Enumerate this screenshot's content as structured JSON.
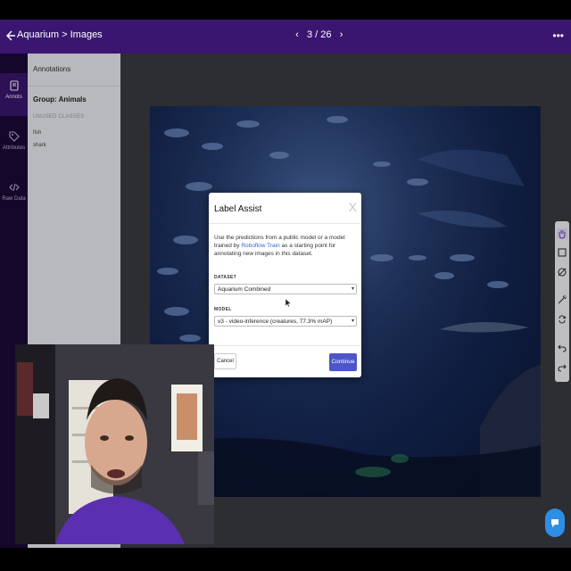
{
  "header": {
    "breadcrumb": "Aquarium > Images",
    "pager": "3 / 26",
    "prev_icon": "chevron-left-icon",
    "next_icon": "chevron-right-icon",
    "back_icon": "arrow-left-icon",
    "more_icon": "more-dots-icon"
  },
  "nav": {
    "items": [
      {
        "label": "Annots",
        "icon": "annotation-doc-icon",
        "active": true
      },
      {
        "label": "Attributes",
        "icon": "tag-icon",
        "active": false
      },
      {
        "label": "Raw Data",
        "icon": "code-icon",
        "active": false
      }
    ]
  },
  "panel": {
    "title": "Annotations",
    "group": "Group: Animals",
    "unused_heading": "UNUSED CLASSES",
    "classes": [
      "fish",
      "shark"
    ]
  },
  "tools": [
    "hand-icon",
    "box-icon",
    "polygon-icon",
    "smart-select-icon",
    "repeat-icon",
    "undo-icon",
    "redo-icon"
  ],
  "modal": {
    "title": "Label Assist",
    "close": "X",
    "desc_before": "Use the predictions from a public model or a model trained by ",
    "desc_link": "Roboflow Train",
    "desc_after": " as a starting point for annotating new images in this dataset.",
    "dataset_label": "DATASET",
    "dataset_value": "Aquarium Combined",
    "model_label": "MODEL",
    "model_value": "v3 - video-inference (creatures, 77.3% mAP)",
    "cancel_label": "Cancel",
    "continue_label": "Continue"
  },
  "colors": {
    "header": "#3a1670",
    "sidebar": "#1c0a38",
    "primary_button": "#4c56c9",
    "link": "#2c69d1",
    "chat_bubble": "#2d8ee6"
  },
  "chat": {
    "icon": "chat-bubble-icon"
  }
}
